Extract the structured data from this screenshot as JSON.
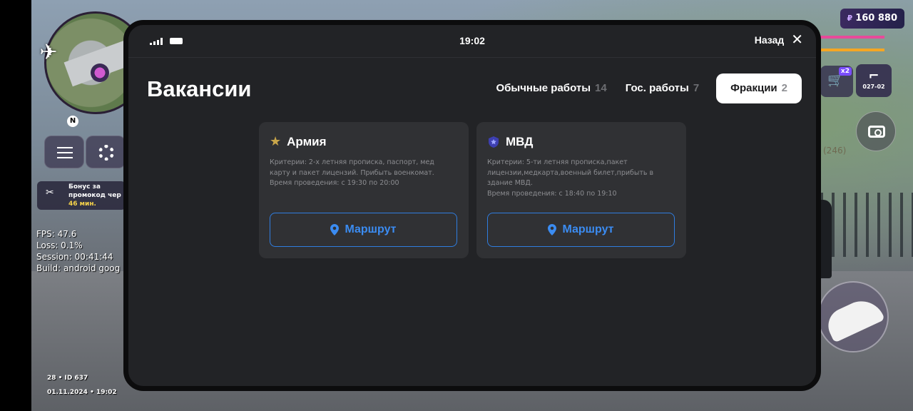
{
  "hud": {
    "money_currency": "₽",
    "money": "160 880",
    "cart_badge": "x2",
    "weapon_label": "027-02",
    "nick_suffix": "(246)",
    "bonus": {
      "line1": "Бонус за",
      "line2": "промокод чер",
      "time": "46 мин."
    },
    "stats": {
      "fps": "FPS: 47.6",
      "loss": "Loss: 0.1%",
      "session": "Session: 00:41:44",
      "build": "Build: android goog"
    },
    "id_line": "28 • ID 637",
    "date_line": "01.11.2024 • 19:02",
    "minimap_north": "N",
    "colors": {
      "health": "#e84a9a",
      "armor": "#f5a623",
      "accent": "#7a4dff"
    }
  },
  "modal": {
    "clock": "19:02",
    "back_label": "Назад",
    "close_icon": "✕",
    "title": "Вакансии",
    "tabs": [
      {
        "label": "Обычные работы",
        "count": "14",
        "active": false
      },
      {
        "label": "Гос. работы",
        "count": "7",
        "active": false
      },
      {
        "label": "Фракции",
        "count": "2",
        "active": true
      }
    ],
    "cards": [
      {
        "title": "Армия",
        "icon": "star-icon",
        "desc": "Критерии: 2-х летняя прописка, паспорт, мед карту и пакет лицензий. Прибыть военкомат.",
        "time": "Время проведения: с 19:30 по 20:00",
        "button": "Маршрут"
      },
      {
        "title": "МВД",
        "icon": "shield-icon",
        "desc": "Критерии: 5-ти летняя прописка,пакет лицензии,медкарта,военный билет,прибыть в здание МВД.",
        "time": "Время проведения: с 18:40 по 19:10",
        "button": "Маршрут"
      }
    ],
    "colors": {
      "background": "#222326",
      "card": "#303134",
      "route_accent": "#3b8cf2"
    }
  }
}
